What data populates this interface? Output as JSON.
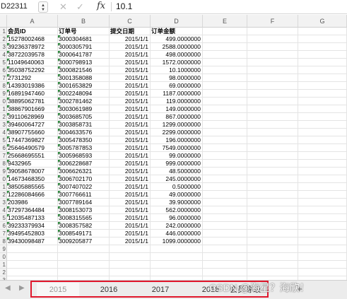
{
  "formula_bar": {
    "cell_ref": "D22311",
    "fx_symbol": "fx",
    "value": "10.1",
    "cancel_icon": "cross-icon",
    "confirm_icon": "checkmark-icon"
  },
  "columns": [
    "A",
    "B",
    "C",
    "D",
    "E",
    "F",
    "G"
  ],
  "headers": {
    "member_id": "会员ID",
    "order_no": "订单号",
    "date": "提交日期",
    "amount": "订单金额"
  },
  "row_numbers": [
    "1",
    "2",
    "3",
    "4",
    "5",
    "6",
    "7",
    "8",
    "9",
    "0",
    "1",
    "2",
    "3",
    "4",
    "5",
    "6",
    "7",
    "8",
    "9",
    "0",
    "1",
    "2",
    "3",
    "4",
    "5",
    "6",
    "7",
    "8",
    "9",
    "0",
    "1",
    "2",
    "3"
  ],
  "rows": [
    {
      "member_id": "15278002468",
      "order_no": "3000304681",
      "date": "2015/1/1",
      "amount": "499.0000000"
    },
    {
      "member_id": "39236378972",
      "order_no": "3000305791",
      "date": "2015/1/1",
      "amount": "2588.0000000"
    },
    {
      "member_id": "38722039578",
      "order_no": "3000641787",
      "date": "2015/1/1",
      "amount": "498.0000000"
    },
    {
      "member_id": "11049640063",
      "order_no": "3000798913",
      "date": "2015/1/1",
      "amount": "1572.0000000"
    },
    {
      "member_id": "35038752292",
      "order_no": "3000821546",
      "date": "2015/1/1",
      "amount": "10.1000000"
    },
    {
      "member_id": "2731292",
      "order_no": "3001358088",
      "date": "2015/1/1",
      "amount": "98.0000000"
    },
    {
      "member_id": "14393019386",
      "order_no": "3001653829",
      "date": "2015/1/1",
      "amount": "69.0000000"
    },
    {
      "member_id": "16891947460",
      "order_no": "3002248094",
      "date": "2015/1/1",
      "amount": "1187.0000000"
    },
    {
      "member_id": "38895062781",
      "order_no": "3002781462",
      "date": "2015/1/1",
      "amount": "119.0000000"
    },
    {
      "member_id": "38867901669",
      "order_no": "3003061989",
      "date": "2015/1/1",
      "amount": "149.0000000"
    },
    {
      "member_id": "39110628969",
      "order_no": "3003685705",
      "date": "2015/1/1",
      "amount": "867.0000000"
    },
    {
      "member_id": "39460064727",
      "order_no": "3003858731",
      "date": "2015/1/1",
      "amount": "1299.0000000"
    },
    {
      "member_id": "38907755660",
      "order_no": "3004633576",
      "date": "2015/1/1",
      "amount": "2299.0000000"
    },
    {
      "member_id": "17447369827",
      "order_no": "3005478350",
      "date": "2015/1/1",
      "amount": "196.0000000"
    },
    {
      "member_id": "25646490579",
      "order_no": "3005787853",
      "date": "2015/1/1",
      "amount": "7549.0000000"
    },
    {
      "member_id": "25668695551",
      "order_no": "3005968593",
      "date": "2015/1/1",
      "amount": "99.0000000"
    },
    {
      "member_id": "9432965",
      "order_no": "3006228687",
      "date": "2015/1/1",
      "amount": "999.0000000"
    },
    {
      "member_id": "39058678007",
      "order_no": "3006626321",
      "date": "2015/1/1",
      "amount": "48.5000000"
    },
    {
      "member_id": "14673468350",
      "order_no": "3006702170",
      "date": "2015/1/1",
      "amount": "245.0000000"
    },
    {
      "member_id": "38505885565",
      "order_no": "3007407022",
      "date": "2015/1/1",
      "amount": "0.5000000"
    },
    {
      "member_id": "12286084666",
      "order_no": "3007766611",
      "date": "2015/1/1",
      "amount": "49.0000000"
    },
    {
      "member_id": "203986",
      "order_no": "3007789164",
      "date": "2015/1/1",
      "amount": "39.9000000"
    },
    {
      "member_id": "37297364484",
      "order_no": "3008153073",
      "date": "2015/1/1",
      "amount": "562.0000000"
    },
    {
      "member_id": "12035487133",
      "order_no": "3008315565",
      "date": "2015/1/1",
      "amount": "96.0000000"
    },
    {
      "member_id": "39233379934",
      "order_no": "3008357582",
      "date": "2015/1/1",
      "amount": "242.0000000"
    },
    {
      "member_id": "39495452803",
      "order_no": "3008549171",
      "date": "2015/1/1",
      "amount": "446.0000000"
    },
    {
      "member_id": "39430098487",
      "order_no": "3009205877",
      "date": "2015/1/1",
      "amount": "1099.0000000"
    }
  ],
  "sheet_tabs": {
    "nav_left_icon": "triangle-left-icon",
    "nav_right_icon": "triangle-right-icon",
    "tabs": [
      {
        "label": "2015",
        "active": true
      },
      {
        "label": "2016",
        "active": false
      },
      {
        "label": "2017",
        "active": false
      },
      {
        "label": "2018",
        "active": false
      },
      {
        "label": "会员等级",
        "active": false
      }
    ],
    "add_label": "+",
    "highlight_color": "#e0182d"
  },
  "watermark": "CSDN @海星？海欣！"
}
